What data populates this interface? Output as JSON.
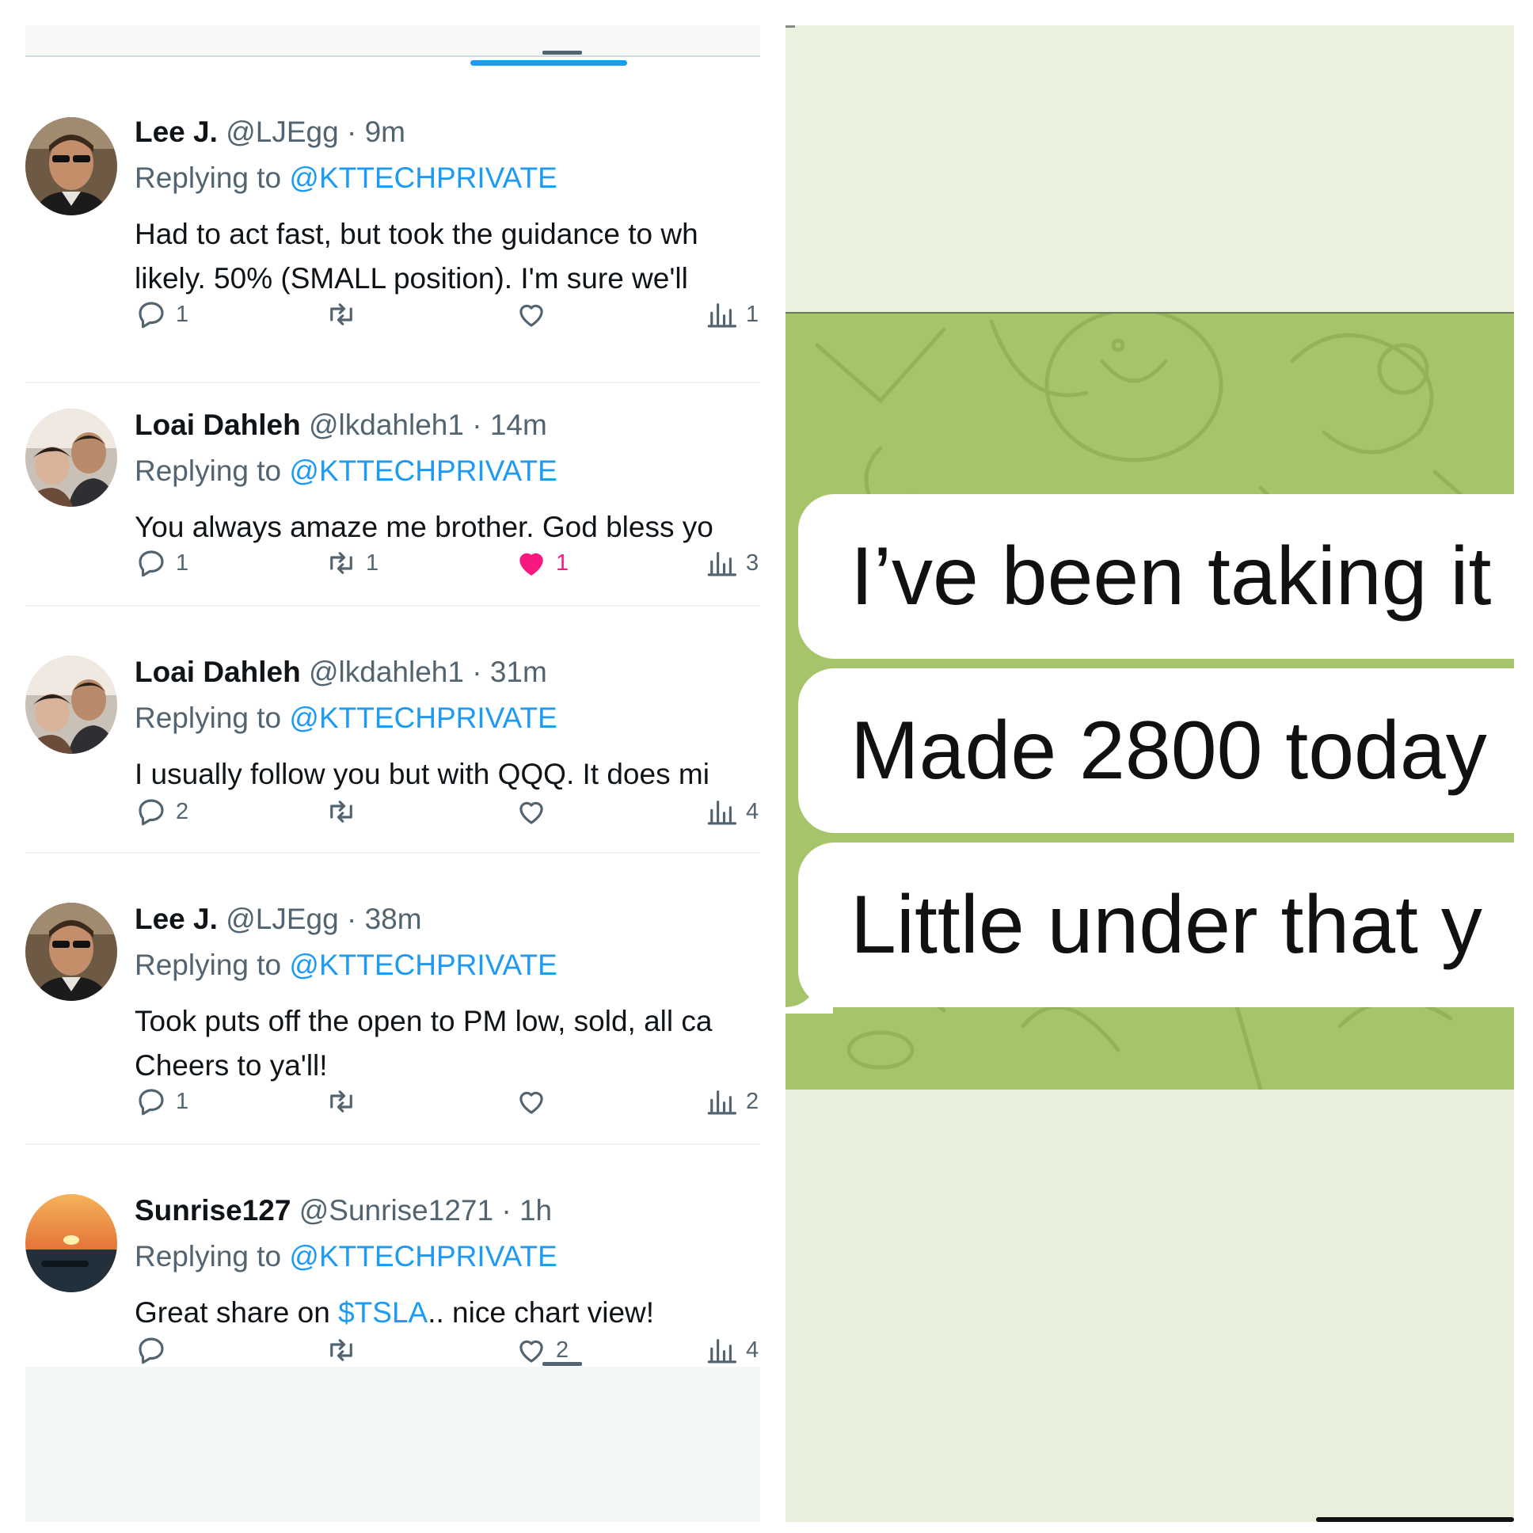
{
  "left_panel": {
    "tweets": [
      {
        "name": "Lee J.",
        "handle": "@LJEgg",
        "time": "9m",
        "replying_prefix": "Replying to",
        "replying_handle": "@KTTECHPRIVATE",
        "text_lines": [
          "Had to act fast, but took the guidance to wh",
          "likely.  50% (SMALL position).  I'm sure we'll"
        ],
        "reply_count": "1",
        "retweet_count": "",
        "like_count": "",
        "liked": false,
        "views": "1"
      },
      {
        "name": "Loai Dahleh",
        "handle": "@lkdahleh1",
        "time": "14m",
        "replying_prefix": "Replying to",
        "replying_handle": "@KTTECHPRIVATE",
        "text_lines": [
          "You always amaze me brother. God bless yo"
        ],
        "reply_count": "1",
        "retweet_count": "1",
        "like_count": "1",
        "liked": true,
        "views": "3"
      },
      {
        "name": "Loai Dahleh",
        "handle": "@lkdahleh1",
        "time": "31m",
        "replying_prefix": "Replying to",
        "replying_handle": "@KTTECHPRIVATE",
        "text_lines": [
          "I usually follow you but with QQQ. It does mi"
        ],
        "reply_count": "2",
        "retweet_count": "",
        "like_count": "",
        "liked": false,
        "views": "4"
      },
      {
        "name": "Lee J.",
        "handle": "@LJEgg",
        "time": "38m",
        "replying_prefix": "Replying to",
        "replying_handle": "@KTTECHPRIVATE",
        "text_lines": [
          "Took puts off the open to PM low, sold, all ca",
          "Cheers to ya'll!"
        ],
        "reply_count": "1",
        "retweet_count": "",
        "like_count": "",
        "liked": false,
        "views": "2"
      },
      {
        "name": "Sunrise127",
        "handle": "@Sunrise1271",
        "time": "1h",
        "replying_prefix": "Replying to",
        "replying_handle": "@KTTECHPRIVATE",
        "text_before": "Great share on ",
        "text_link": "$TSLA",
        "text_after": ".. nice chart view!",
        "reply_count": "",
        "retweet_count": "",
        "like_count": "2",
        "liked": false,
        "views": "4"
      }
    ]
  },
  "right_panel": {
    "messages": [
      "I’ve been taking it",
      "Made 2800 today",
      "Little under that y"
    ]
  },
  "colors": {
    "twitter_blue": "#1d9bf0",
    "muted_gray": "#536471",
    "like_pink": "#f91880",
    "telegram_wallpaper": "#a6c46a",
    "bubble_white": "#ffffff"
  },
  "icons": [
    "reply-icon",
    "retweet-icon",
    "heart-icon",
    "views-icon"
  ]
}
